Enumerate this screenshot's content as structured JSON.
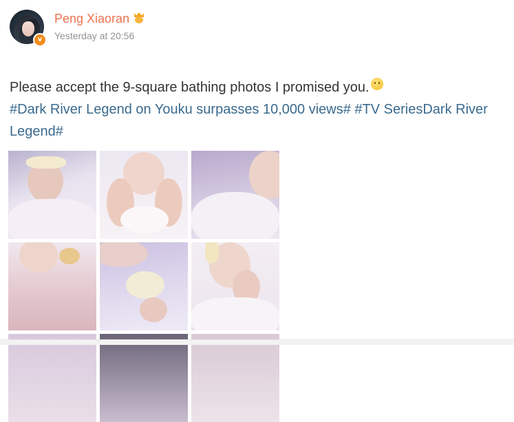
{
  "post": {
    "author": {
      "name": "Peng Xiaoran",
      "verified": true,
      "verified_badge": "v",
      "emblem_icon": "crown-emoji-icon"
    },
    "timestamp": "Yesterday at 20:56",
    "text": "Please accept the 9-square bathing photos I promised you.",
    "emoji_icon": "smile-emoji-icon",
    "hashtags": [
      "#Dark River Legend on Youku surpasses 10,000 views#",
      "#TV SeriesDark River Legend#"
    ],
    "photos": [
      {
        "id": 1,
        "alt": ""
      },
      {
        "id": 2,
        "alt": ""
      },
      {
        "id": 3,
        "alt": ""
      },
      {
        "id": 4,
        "alt": ""
      },
      {
        "id": 5,
        "alt": ""
      },
      {
        "id": 6,
        "alt": ""
      },
      {
        "id": 7,
        "alt": ""
      },
      {
        "id": 8,
        "alt": ""
      },
      {
        "id": 9,
        "alt": ""
      }
    ]
  },
  "colors": {
    "username": "#eb7350",
    "hashtag": "#3a6a8e",
    "timestamp": "#939393",
    "body_text": "#333333",
    "verified_badge": "#f28c1b"
  }
}
